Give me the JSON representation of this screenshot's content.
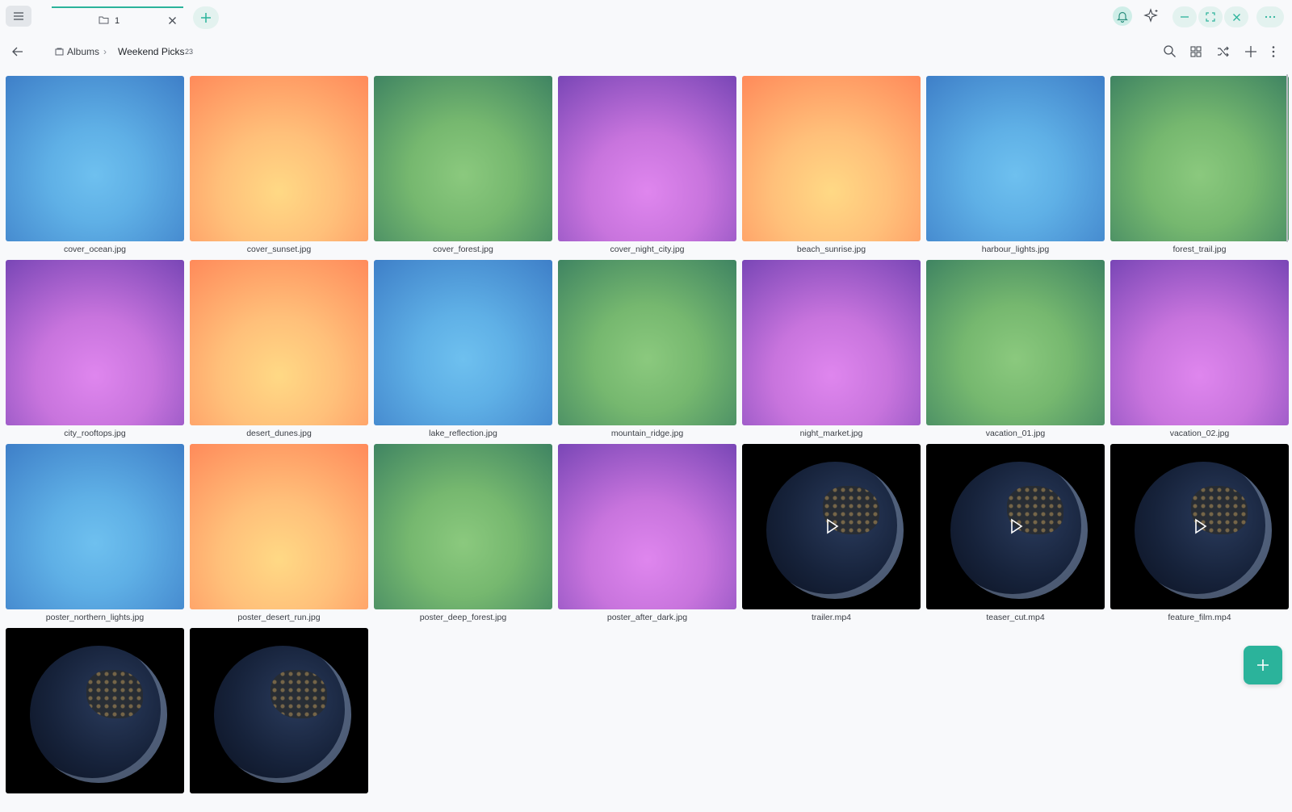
{
  "tab": {
    "label": "1"
  },
  "breadcrumb": {
    "root": "Albums",
    "separator": "›",
    "current": "Weekend Picks",
    "count": "23"
  },
  "colors": {
    "accent": "#2bb39b",
    "accent_soft": "#e3f2ef"
  },
  "icons": [
    "menu-icon",
    "folder-icon",
    "close-icon",
    "plus-icon",
    "bell-icon",
    "sparkle-icon",
    "minimize-icon",
    "maximize-icon",
    "more-icon",
    "back-icon",
    "album-icon",
    "search-icon",
    "grid-view-icon",
    "shuffle-icon",
    "add-icon",
    "kebab-icon",
    "play-icon"
  ],
  "items": [
    {
      "name": "cover_ocean.jpg",
      "kind": "blue"
    },
    {
      "name": "cover_sunset.jpg",
      "kind": "orange"
    },
    {
      "name": "cover_forest.jpg",
      "kind": "green"
    },
    {
      "name": "cover_night_city.jpg",
      "kind": "purple"
    },
    {
      "name": "beach_sunrise.jpg",
      "kind": "orange"
    },
    {
      "name": "harbour_lights.jpg",
      "kind": "blue"
    },
    {
      "name": "forest_trail.jpg",
      "kind": "green"
    },
    {
      "name": "city_rooftops.jpg",
      "kind": "purple"
    },
    {
      "name": "desert_dunes.jpg",
      "kind": "orange"
    },
    {
      "name": "lake_reflection.jpg",
      "kind": "blue"
    },
    {
      "name": "mountain_ridge.jpg",
      "kind": "green"
    },
    {
      "name": "night_market.jpg",
      "kind": "purple"
    },
    {
      "name": "vacation_01.jpg",
      "kind": "green"
    },
    {
      "name": "vacation_02.jpg",
      "kind": "purple"
    },
    {
      "name": "poster_northern_lights.jpg",
      "kind": "blue"
    },
    {
      "name": "poster_desert_run.jpg",
      "kind": "orange"
    },
    {
      "name": "poster_deep_forest.jpg",
      "kind": "green"
    },
    {
      "name": "poster_after_dark.jpg",
      "kind": "purple"
    },
    {
      "name": "trailer.mp4",
      "kind": "video"
    },
    {
      "name": "teaser_cut.mp4",
      "kind": "video"
    },
    {
      "name": "feature_film.mp4",
      "kind": "video"
    },
    {
      "name": "",
      "kind": "video"
    },
    {
      "name": "",
      "kind": "video"
    }
  ]
}
